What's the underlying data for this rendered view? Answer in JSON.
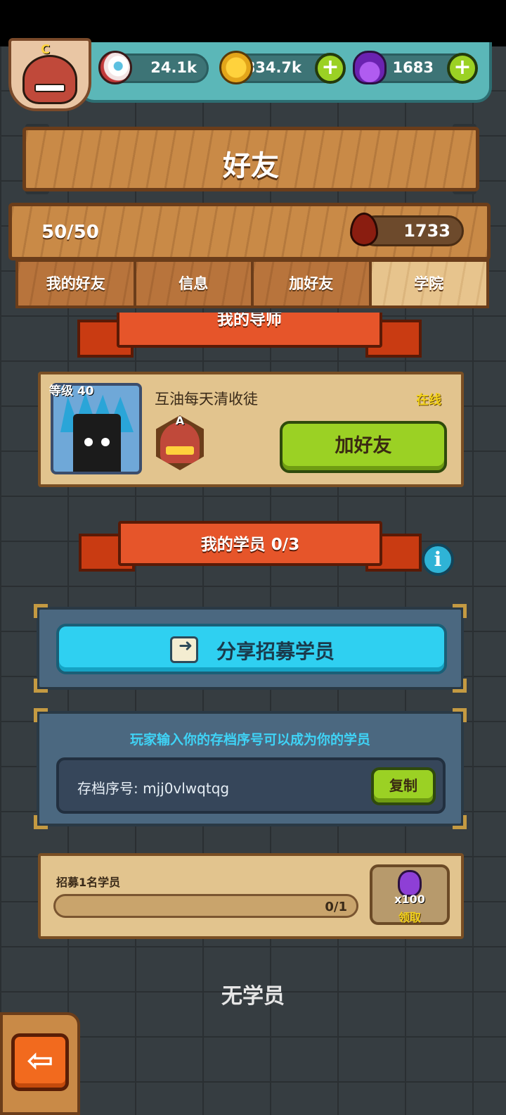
{
  "header": {
    "eyes": "24.1k",
    "coins": "834.7k",
    "potions": "1683",
    "avatar_rank": "C",
    "plus_symbol": "+"
  },
  "title": "好友",
  "friends": {
    "count": "50/50",
    "blood": "1733"
  },
  "tabs": [
    {
      "label": "我的好友",
      "active": false
    },
    {
      "label": "信息",
      "active": false
    },
    {
      "label": "加好友",
      "active": false
    },
    {
      "label": "学院",
      "active": true
    }
  ],
  "mentor_section": {
    "title": "我的导师",
    "level": "等级 40",
    "name": "互油每天清收徒",
    "status": "在线",
    "rank": "A",
    "add_friend": "加好友"
  },
  "students_section": {
    "title": "我的学员 0/3",
    "info_icon": "i",
    "share_button": "分享招募学员",
    "hint": "玩家输入你的存档序号可以成为你的学员",
    "code_label": "存档序号: mjj0vlwqtqg",
    "copy_button": "复制"
  },
  "task": {
    "title": "招募1名学员",
    "progress_text": "0/1",
    "progress": 0,
    "reward_qty": "x100",
    "claim": "领取"
  },
  "empty_text": "无学员",
  "back_arrow": "⇦"
}
